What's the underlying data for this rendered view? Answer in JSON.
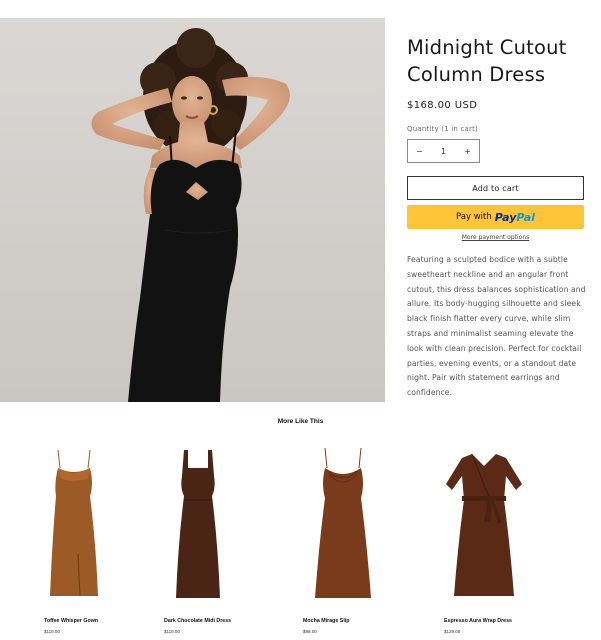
{
  "product": {
    "title_line1": "Midnight Cutout",
    "title_line2": "Column Dress",
    "price": "$168.00 USD",
    "quantity_label": "Quantity (1 in cart)",
    "quantity_value": "1",
    "minus_symbol": "−",
    "plus_symbol": "+",
    "add_to_cart": "Add to cart",
    "paypal_prefix": "Pay with",
    "paypal_brand_1": "Pay",
    "paypal_brand_2": "Pal",
    "more_payment": "More payment options",
    "description": "Featuring a sculpted bodice with a subtle sweetheart neckline and an angular front cutout, this dress balances sophistication and allure. Its body-hugging silhouette and sleek black finish flatter every curve, while slim straps and minimalist seaming elevate the look with clean precision. Perfect for cocktail parties, evening events, or a standout date night. Pair with statement earrings and confidence."
  },
  "related": {
    "title": "More Like This",
    "items": [
      {
        "name": "Toffee Whisper Gown",
        "price": "$119.00",
        "color": "#9c5a26",
        "style": "slip-slit"
      },
      {
        "name": "Dark Chocolate Midi Dress",
        "price": "$119.00",
        "color": "#4a2414",
        "style": "square-neck"
      },
      {
        "name": "Mocha Mirage Slip",
        "price": "$98.00",
        "color": "#7a3a1c",
        "style": "cowl-slip"
      },
      {
        "name": "Espresso Aura Wrap Dress",
        "price": "$129.00",
        "color": "#5a2a16",
        "style": "wrap"
      }
    ]
  }
}
